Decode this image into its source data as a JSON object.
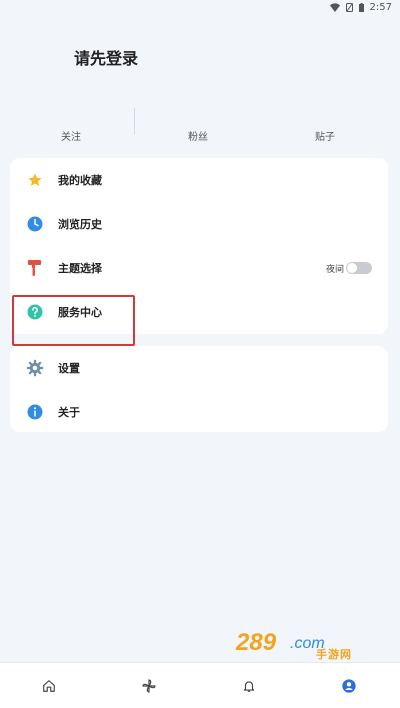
{
  "status_bar": {
    "time": "2:57"
  },
  "header": {
    "login_prompt": "请先登录"
  },
  "stats": [
    {
      "label": "关注"
    },
    {
      "label": "粉丝"
    },
    {
      "label": "贴子"
    }
  ],
  "menu": {
    "favorites": {
      "label": "我的收藏",
      "icon": "star-icon",
      "color": "#f7b928"
    },
    "history": {
      "label": "浏览历史",
      "icon": "clock-icon",
      "color": "#2f8de4"
    },
    "theme": {
      "label": "主题选择",
      "icon": "paint-roller-icon",
      "color": "#e1533f",
      "toggle_label": "夜间",
      "toggle_on": false
    },
    "service": {
      "label": "服务中心",
      "icon": "help-circle-icon",
      "color": "#2ec4a8"
    },
    "settings": {
      "label": "设置",
      "icon": "gear-icon",
      "color": "#6f8fa8"
    },
    "about": {
      "label": "关于",
      "icon": "info-icon",
      "color": "#2f8de4"
    }
  },
  "highlight_color": "#d23a3a",
  "bottom_nav": [
    {
      "name": "home",
      "icon": "home-icon",
      "active": false
    },
    {
      "name": "discover",
      "icon": "pinwheel-icon",
      "active": false
    },
    {
      "name": "notifications",
      "icon": "bell-icon",
      "active": false
    },
    {
      "name": "profile",
      "icon": "user-icon",
      "active": true
    }
  ],
  "watermark": {
    "text": "手游网",
    "brand": "289.com"
  }
}
